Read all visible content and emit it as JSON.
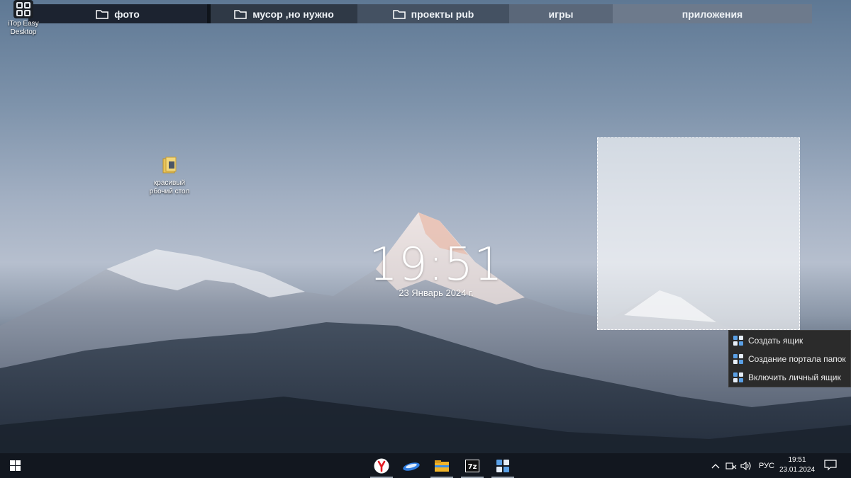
{
  "fences": [
    {
      "label": "фото",
      "icon": "folder-icon",
      "bg": "#1c2330"
    },
    {
      "label": "мусор ,но нужно",
      "icon": "folder-icon",
      "bg": "#2f3946"
    },
    {
      "label": "проекты pub",
      "icon": "folder-icon",
      "bg": "#445162"
    },
    {
      "label": "игры",
      "icon": "",
      "bg": "#5a6779"
    },
    {
      "label": "приложения",
      "icon": "",
      "bg": "#6d7a8c"
    }
  ],
  "itop_app": {
    "label_line1": "iTop Easy",
    "label_line2": "Desktop"
  },
  "desktop_icon": {
    "label_line1": "красивый",
    "label_line2": "рбочий стол"
  },
  "clock": {
    "time": "19:51",
    "date": "23 Январь 2024 г."
  },
  "context_menu": {
    "items": [
      {
        "label": "Создать ящик"
      },
      {
        "label": "Создание портала папок"
      },
      {
        "label": "Включить личный ящик"
      }
    ]
  },
  "taskbar": {
    "pinned": [
      "yandex-browser-icon",
      "cloud-app-icon",
      "file-explorer-icon",
      "7zip-icon",
      "itop-easy-desktop-icon"
    ],
    "tray": {
      "language": "РУС",
      "time": "19:51",
      "date": "23.01.2024"
    }
  },
  "colors": {
    "taskbar": "#12171f",
    "menu_bg": "#2b2b2b",
    "selection": "#ffffff"
  }
}
